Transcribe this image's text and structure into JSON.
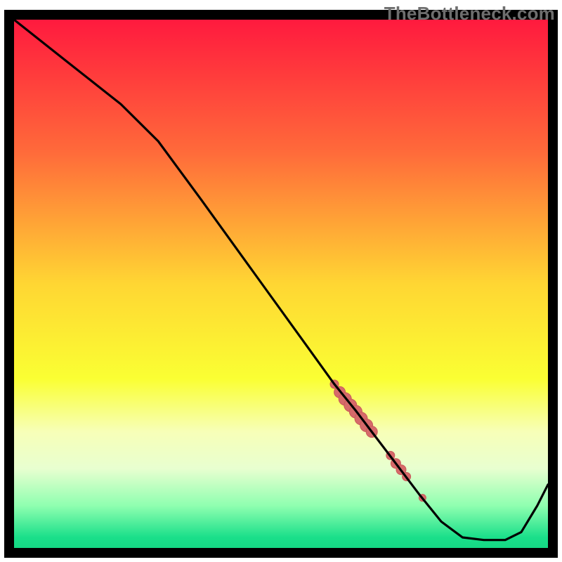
{
  "watermark": "TheBottleneck.com",
  "colors": {
    "border": "#000000",
    "grad_stops": [
      {
        "offset": 0.0,
        "color": "#ff1a3e"
      },
      {
        "offset": 0.25,
        "color": "#ff6a3a"
      },
      {
        "offset": 0.5,
        "color": "#ffd633"
      },
      {
        "offset": 0.68,
        "color": "#faff33"
      },
      {
        "offset": 0.78,
        "color": "#f7ffb8"
      },
      {
        "offset": 0.85,
        "color": "#e8ffd0"
      },
      {
        "offset": 0.92,
        "color": "#8fffb0"
      },
      {
        "offset": 0.98,
        "color": "#1adf8a"
      },
      {
        "offset": 1.0,
        "color": "#15d884"
      }
    ],
    "marker_fill": "#d66a6a",
    "marker_stroke": "#c85a5a",
    "line": "#000000"
  },
  "chart_data": {
    "type": "line",
    "title": "",
    "xlabel": "",
    "ylabel": "",
    "xlim": [
      0,
      100
    ],
    "ylim": [
      0,
      100
    ],
    "grid": false,
    "legend": false,
    "comment": "Approximate curve read off the image. Y is 'distance from optimal' (high=bad/red, low=good/green). The flat near-zero region around x≈82–93 is the optimal zone.",
    "series": [
      {
        "name": "bottleneck-curve",
        "x": [
          0,
          10,
          20,
          27,
          35,
          45,
          55,
          60,
          64,
          67,
          70,
          73,
          76,
          80,
          84,
          88,
          92,
          95,
          98,
          100
        ],
        "y": [
          100,
          92,
          84,
          77,
          66,
          52,
          38,
          31,
          26,
          22,
          18,
          14,
          10,
          5,
          2,
          1.5,
          1.5,
          3,
          8,
          12
        ]
      }
    ],
    "markers": {
      "comment": "Highlighted salmon segments/points along the curve in the lower-right quadrant.",
      "points": [
        {
          "x": 60.0,
          "y": 31.0,
          "r": 6
        },
        {
          "x": 61.0,
          "y": 29.5,
          "r": 8
        },
        {
          "x": 62.0,
          "y": 28.2,
          "r": 9
        },
        {
          "x": 63.0,
          "y": 27.0,
          "r": 9
        },
        {
          "x": 64.0,
          "y": 25.8,
          "r": 9
        },
        {
          "x": 65.0,
          "y": 24.5,
          "r": 9
        },
        {
          "x": 66.0,
          "y": 23.2,
          "r": 9
        },
        {
          "x": 67.0,
          "y": 22.0,
          "r": 8
        },
        {
          "x": 70.5,
          "y": 17.5,
          "r": 6
        },
        {
          "x": 71.5,
          "y": 16.0,
          "r": 7
        },
        {
          "x": 72.5,
          "y": 14.8,
          "r": 7
        },
        {
          "x": 73.5,
          "y": 13.5,
          "r": 6
        },
        {
          "x": 76.5,
          "y": 9.5,
          "r": 5
        }
      ]
    }
  }
}
